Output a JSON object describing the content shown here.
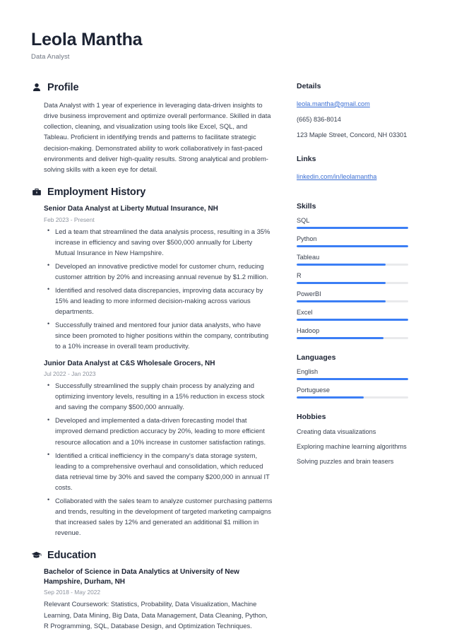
{
  "header": {
    "full_name": "Leola Mantha",
    "job_title": "Data Analyst"
  },
  "accent_color": "#3b7ef5",
  "link_color": "#3b6fd4",
  "main": {
    "profile": {
      "icon": "user-icon",
      "title": "Profile",
      "text": "Data Analyst with 1 year of experience in leveraging data-driven insights to drive business improvement and optimize overall performance. Skilled in data collection, cleaning, and visualization using tools like Excel, SQL, and Tableau. Proficient in identifying trends and patterns to facilitate strategic decision-making. Demonstrated ability to work collaboratively in fast-paced environments and deliver high-quality results. Strong analytical and problem-solving skills with a keen eye for detail."
    },
    "employment": {
      "icon": "briefcase-icon",
      "title": "Employment History",
      "entries": [
        {
          "title": "Senior Data Analyst at Liberty Mutual Insurance, NH",
          "date": "Feb 2023 - Present",
          "bullets": [
            "Led a team that streamlined the data analysis process, resulting in a 35% increase in efficiency and saving over $500,000 annually for Liberty Mutual Insurance in New Hampshire.",
            "Developed an innovative predictive model for customer churn, reducing customer attrition by 20% and increasing annual revenue by $1.2 million.",
            "Identified and resolved data discrepancies, improving data accuracy by 15% and leading to more informed decision-making across various departments.",
            "Successfully trained and mentored four junior data analysts, who have since been promoted to higher positions within the company, contributing to a 10% increase in overall team productivity."
          ]
        },
        {
          "title": "Junior Data Analyst at C&S Wholesale Grocers, NH",
          "date": "Jul 2022 - Jan 2023",
          "bullets": [
            "Successfully streamlined the supply chain process by analyzing and optimizing inventory levels, resulting in a 15% reduction in excess stock and saving the company $500,000 annually.",
            "Developed and implemented a data-driven forecasting model that improved demand prediction accuracy by 20%, leading to more efficient resource allocation and a 10% increase in customer satisfaction ratings.",
            "Identified a critical inefficiency in the company's data storage system, leading to a comprehensive overhaul and consolidation, which reduced data retrieval time by 30% and saved the company $200,000 in annual IT costs.",
            "Collaborated with the sales team to analyze customer purchasing patterns and trends, resulting in the development of targeted marketing campaigns that increased sales by 12% and generated an additional $1 million in revenue."
          ]
        }
      ]
    },
    "education": {
      "icon": "graduation-cap-icon",
      "title": "Education",
      "entries": [
        {
          "title": "Bachelor of Science in Data Analytics at University of New Hampshire, Durham, NH",
          "date": "Sep 2018 - May 2022",
          "note": "Relevant Coursework: Statistics, Probability, Data Visualization, Machine Learning, Data Mining, Big Data, Data Management, Data Cleaning, Python, R Programming, SQL, Database Design, and Optimization Techniques."
        }
      ]
    }
  },
  "sidebar": {
    "details": {
      "title": "Details",
      "email": "leola.mantha@gmail.com",
      "phone": "(665) 836-8014",
      "address": "123 Maple Street, Concord, NH 03301"
    },
    "links": {
      "title": "Links",
      "items": [
        {
          "label": "linkedin.com/in/leolamantha"
        }
      ]
    },
    "skills": {
      "title": "Skills",
      "items": [
        {
          "label": "SQL",
          "level": 100
        },
        {
          "label": "Python",
          "level": 100
        },
        {
          "label": "Tableau",
          "level": 80
        },
        {
          "label": "R",
          "level": 80
        },
        {
          "label": "PowerBI",
          "level": 80
        },
        {
          "label": "Excel",
          "level": 100
        },
        {
          "label": "Hadoop",
          "level": 78
        }
      ]
    },
    "languages": {
      "title": "Languages",
      "items": [
        {
          "label": "English",
          "level": 100
        },
        {
          "label": "Portuguese",
          "level": 60
        }
      ]
    },
    "hobbies": {
      "title": "Hobbies",
      "items": [
        {
          "label": "Creating data visualizations"
        },
        {
          "label": "Exploring machine learning algorithms"
        },
        {
          "label": "Solving puzzles and brain teasers"
        }
      ]
    }
  }
}
